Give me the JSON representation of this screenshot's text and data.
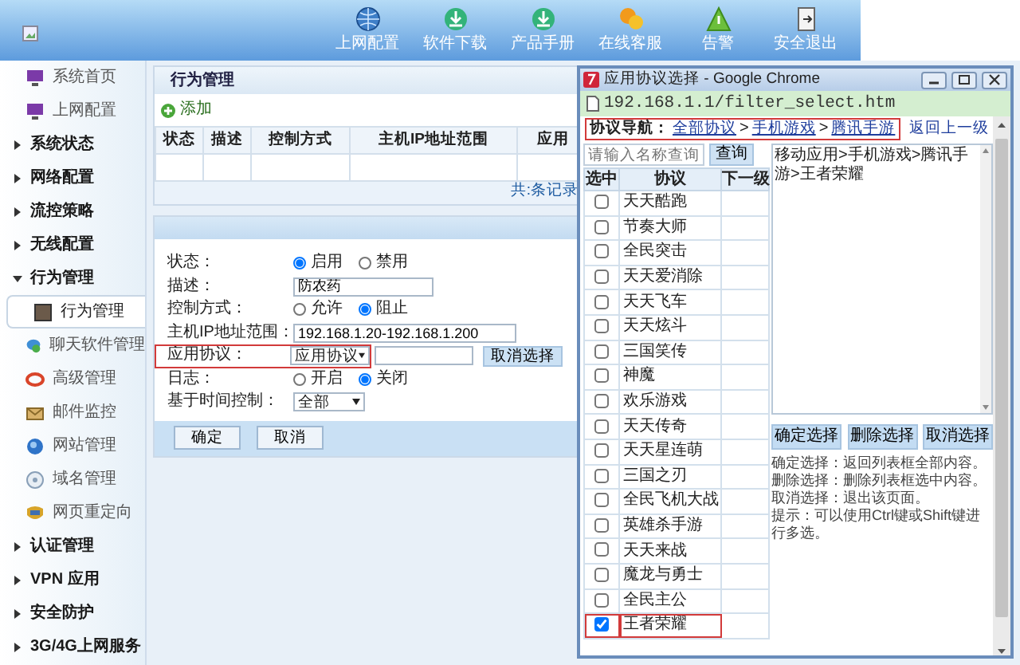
{
  "header": {
    "nav": [
      "上网配置",
      "软件下载",
      "产品手册",
      "在线客服",
      "告警",
      "安全退出"
    ]
  },
  "sidebar": {
    "items": [
      {
        "kind": "link",
        "label": "系统首页"
      },
      {
        "kind": "link",
        "label": "上网配置"
      },
      {
        "kind": "group",
        "label": "系统状态",
        "expanded": false
      },
      {
        "kind": "group",
        "label": "网络配置",
        "expanded": false
      },
      {
        "kind": "group",
        "label": "流控策略",
        "expanded": false
      },
      {
        "kind": "group",
        "label": "无线配置",
        "expanded": false
      },
      {
        "kind": "group",
        "label": "行为管理",
        "expanded": true,
        "children": [
          {
            "label": "行为管理",
            "selected": true
          },
          {
            "label": "聊天软件管理",
            "selected": false
          },
          {
            "label": "高级管理",
            "selected": false
          },
          {
            "label": "邮件监控",
            "selected": false
          },
          {
            "label": "网站管理",
            "selected": false
          },
          {
            "label": "域名管理",
            "selected": false
          },
          {
            "label": "网页重定向",
            "selected": false
          }
        ]
      },
      {
        "kind": "group",
        "label": "认证管理",
        "expanded": false
      },
      {
        "kind": "group",
        "label": "VPN 应用",
        "expanded": false
      },
      {
        "kind": "group",
        "label": "安全防护",
        "expanded": false
      },
      {
        "kind": "group",
        "label": "3G/4G上网服务",
        "expanded": false
      }
    ]
  },
  "main": {
    "title": "行为管理",
    "add_link": "添加",
    "table": {
      "columns": [
        "状态",
        "描述",
        "控制方式",
        "主机IP地址范围",
        "应用"
      ],
      "footer": "共:条记录"
    },
    "form": {
      "fields": [
        {
          "kind": "radio",
          "label": "状态：",
          "highlighted": false,
          "options": [
            {
              "label": "启用",
              "selected": true
            },
            {
              "label": "禁用",
              "selected": false
            }
          ]
        },
        {
          "kind": "text",
          "label": "描述：",
          "highlighted": false,
          "value": "防农药"
        },
        {
          "kind": "radio",
          "label": "控制方式：",
          "highlighted": false,
          "options": [
            {
              "label": "允许",
              "selected": false
            },
            {
              "label": "阻止",
              "selected": true
            }
          ]
        },
        {
          "kind": "text",
          "label": "主机IP地址范围：",
          "highlighted": false,
          "value": "192.168.1.20-192.168.1.200"
        },
        {
          "kind": "protocol",
          "label": "应用协议：",
          "highlighted": true,
          "value": "应用协议",
          "button": "取消选择"
        },
        {
          "kind": "radio",
          "label": "日志：",
          "highlighted": false,
          "options": [
            {
              "label": "开启",
              "selected": false
            },
            {
              "label": "关闭",
              "selected": true
            }
          ]
        },
        {
          "kind": "select",
          "label": "基于时间控制：",
          "highlighted": false,
          "value": "全部"
        }
      ],
      "buttons": [
        "确定",
        "取消"
      ]
    }
  },
  "popup": {
    "title": "应用协议选择 - Google Chrome",
    "url": "192.168.1.1/filter_select.htm",
    "nav_label": "协议导航：",
    "nav_highlighted": true,
    "breadcrumbs": [
      {
        "label": "全部协议"
      },
      {
        "separator": ">",
        "label": "手机游戏"
      },
      {
        "separator": ">",
        "label": "腾讯手游"
      }
    ],
    "back_link": "返回上一级",
    "search": {
      "placeholder": "请输入名称查询",
      "button": "查询"
    },
    "columns": [
      "选中",
      "协议",
      "下一级"
    ],
    "rows": [
      {
        "name": "天天酷跑",
        "checked": false,
        "highlighted": false
      },
      {
        "name": "节奏大师",
        "checked": false,
        "highlighted": false
      },
      {
        "name": "全民突击",
        "checked": false,
        "highlighted": false
      },
      {
        "name": "天天爱消除",
        "checked": false,
        "highlighted": false
      },
      {
        "name": "天天飞车",
        "checked": false,
        "highlighted": false
      },
      {
        "name": "天天炫斗",
        "checked": false,
        "highlighted": false
      },
      {
        "name": "三国笑传",
        "checked": false,
        "highlighted": false
      },
      {
        "name": "神魔",
        "checked": false,
        "highlighted": false
      },
      {
        "name": "欢乐游戏",
        "checked": false,
        "highlighted": false
      },
      {
        "name": "天天传奇",
        "checked": false,
        "highlighted": false
      },
      {
        "name": "天天星连萌",
        "checked": false,
        "highlighted": false
      },
      {
        "name": "三国之刃",
        "checked": false,
        "highlighted": false
      },
      {
        "name": "全民飞机大战",
        "checked": false,
        "highlighted": false
      },
      {
        "name": "英雄杀手游",
        "checked": false,
        "highlighted": false
      },
      {
        "name": "天天来战",
        "checked": false,
        "highlighted": false
      },
      {
        "name": "魔龙与勇士",
        "checked": false,
        "highlighted": false
      },
      {
        "name": "全民主公",
        "checked": false,
        "highlighted": false
      },
      {
        "name": "王者荣耀",
        "checked": true,
        "highlighted": true
      }
    ],
    "selection_list": [
      "移动应用>手机游戏>腾讯手游>王者荣耀"
    ],
    "buttons": [
      "确定选择",
      "删除选择",
      "取消选择"
    ],
    "help": [
      "确定选择：返回列表框全部内容。",
      "删除选择：删除列表框选中内容。",
      "取消选择：退出该页面。",
      "提示：可以使用Ctrl键或Shift键进行多选。"
    ]
  }
}
